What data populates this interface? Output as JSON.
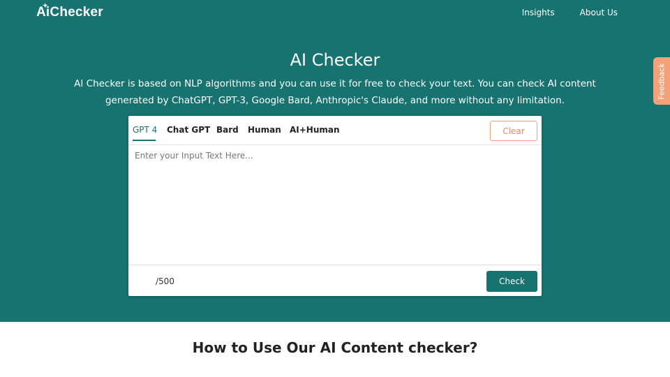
{
  "header": {
    "logo_prefix": "Ai",
    "logo_suffix": "Checker",
    "nav": [
      {
        "label": "Insights"
      },
      {
        "label": "About Us"
      }
    ]
  },
  "hero": {
    "title": "AI Checker",
    "description": "AI Checker is based on NLP algorithms and you can use it for free to check your text. You can check AI content generated by ChatGPT, GPT-3, Google Bard, Anthropic's Claude, and more without any limitation."
  },
  "checker": {
    "tabs": [
      {
        "label": "GPT 4",
        "active": true
      },
      {
        "label": "Chat GPT",
        "active": false
      },
      {
        "label": "Bard",
        "active": false
      },
      {
        "label": "Human",
        "active": false
      },
      {
        "label": "AI+Human",
        "active": false
      }
    ],
    "clear_label": "Clear",
    "input_placeholder": "Enter your Input Text Here...",
    "input_value": "",
    "counter": "/500",
    "check_label": "Check"
  },
  "feedback_label": "Feedback",
  "section": {
    "title": "How to Use Our AI Content checker?"
  },
  "colors": {
    "brand": "#177370",
    "accent": "#f4a178"
  }
}
